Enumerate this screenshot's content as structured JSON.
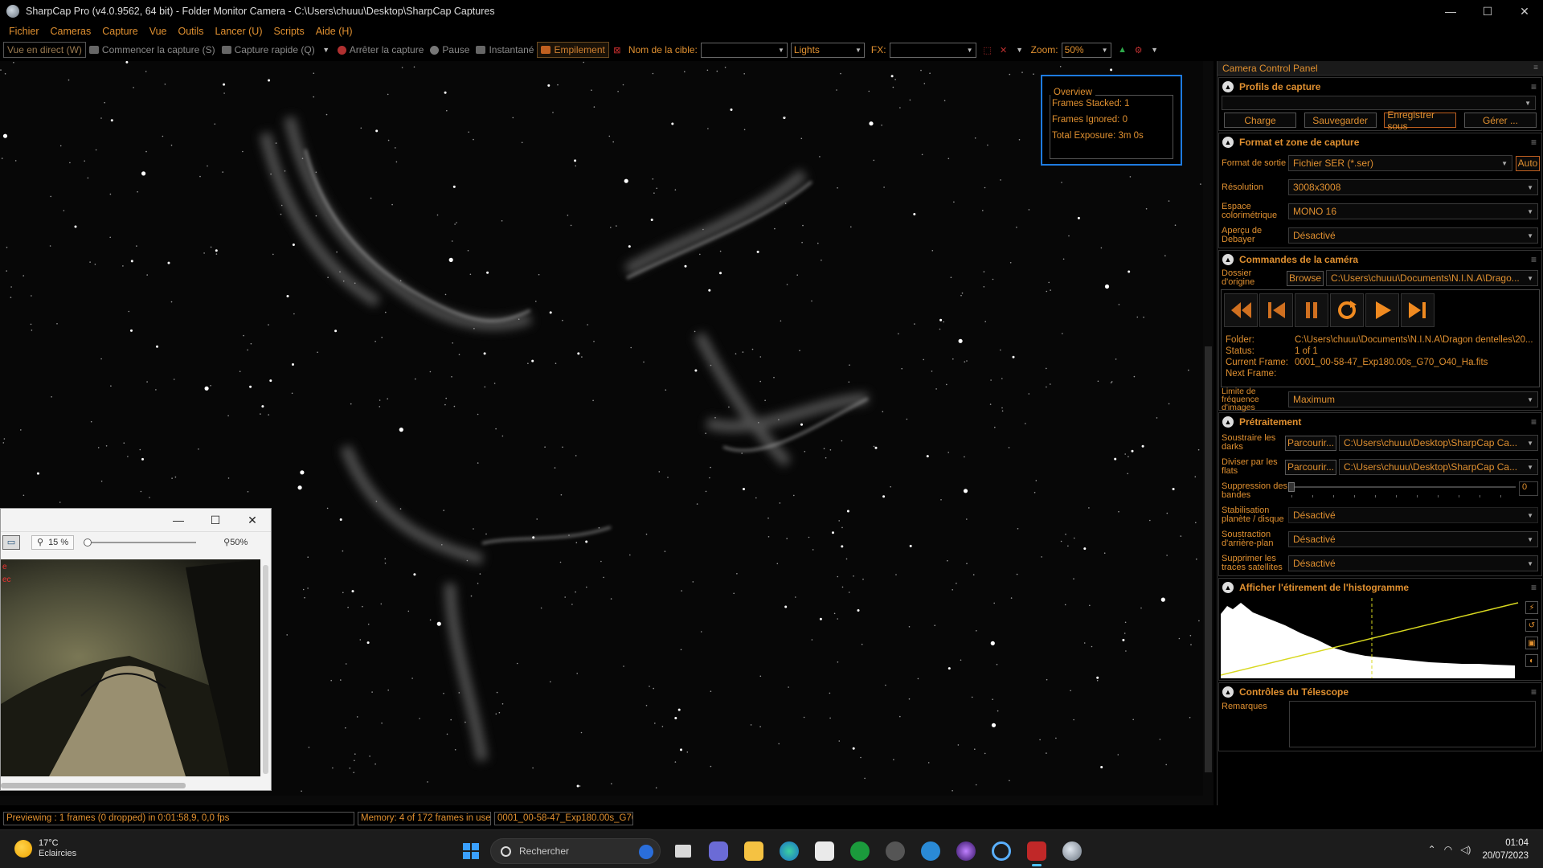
{
  "titlebar": {
    "title": "SharpCap Pro (v4.0.9562, 64 bit) - Folder Monitor Camera - C:\\Users\\chuuu\\Desktop\\SharpCap Captures",
    "minimize": "—",
    "maximize": "☐",
    "close": "✕"
  },
  "menu": [
    "Fichier",
    "Cameras",
    "Capture",
    "Vue",
    "Outils",
    "Lancer (U)",
    "Scripts",
    "Aide (H)"
  ],
  "toolbar": {
    "live_view": "Vue en direct (W)",
    "start_capture": "Commencer la capture (S)",
    "quick_capture": "Capture rapide (Q)",
    "stop_capture": "Arrêter la capture",
    "pause": "Pause",
    "snapshot": "Instantané",
    "stacking": "Empilement",
    "target_label": "Nom de la cible:",
    "target_value": "",
    "frame_type": "Lights",
    "fx_label": "FX:",
    "fx_value": "",
    "zoom_label": "Zoom:",
    "zoom_value": "50%"
  },
  "overview": {
    "title": "Overview",
    "frames_stacked": "Frames Stacked: 1",
    "frames_ignored": "Frames Ignored: 0",
    "total_exposure": "Total Exposure:   3m 0s"
  },
  "floatwin": {
    "zoom_value": "15 %",
    "zoom_max": "50%",
    "minimize": "—",
    "maximize": "☐",
    "close": "✕",
    "side_text_1": "e",
    "side_text_2": "ec"
  },
  "panel": {
    "title": "Camera Control Panel",
    "profiles": {
      "header": "Profils de capture",
      "profile_value": "",
      "buttons": [
        "Charge",
        "Sauvegarder",
        "Enregistrer sous",
        "Gérer ..."
      ]
    },
    "format": {
      "header": "Format et zone de capture",
      "rows": [
        {
          "label": "Format de sortie",
          "value": "Fichier SER (*.ser)"
        },
        {
          "label": "Résolution",
          "value": "3008x3008"
        },
        {
          "label": "Espace colorimétrique",
          "value": "MONO 16"
        },
        {
          "label": "Aperçu de Debayer",
          "value": "Désactivé"
        }
      ],
      "auto_button": "Auto"
    },
    "camera": {
      "header": "Commandes de la caméra",
      "origin_label": "Dossier d'origine",
      "browse_button": "Browse",
      "origin_value": "C:\\Users\\chuuu\\Documents\\N.I.N.A\\Drago...",
      "folder_label": "Folder:",
      "folder_value": "C:\\Users\\chuuu\\Documents\\N.I.N.A\\Dragon dentelles\\20...",
      "status_label": "Status:",
      "status_value": "1 of 1",
      "current_label": "Current Frame:",
      "current_value": "0001_00-58-47_Exp180.00s_G70_O40_Ha.fits",
      "next_label": "Next Frame:",
      "next_value": "",
      "fps_label": "Limite de fréquence d'images",
      "fps_value": "Maximum"
    },
    "preproc": {
      "header": "Prétraitement",
      "darks_label": "Soustraire les darks",
      "darks_btn": "Parcourir...",
      "darks_value": "C:\\Users\\chuuu\\Desktop\\SharpCap Ca...",
      "flats_label": "Diviser par les flats",
      "flats_btn": "Parcourir...",
      "flats_value": "C:\\Users\\chuuu\\Desktop\\SharpCap Ca...",
      "banding_label": "Suppression des bandes",
      "banding_value": "0",
      "banding_level": 0,
      "stab_label": "Stabilisation planète / disque",
      "stab_value": "Désactivé",
      "bg_label": "Soustraction d'arrière-plan",
      "bg_value": "Désactivé",
      "sat_label": "Supprimer les traces satellites",
      "sat_value": "Désactivé"
    },
    "histogram": {
      "header": "Afficher l'étirement de l'histogramme"
    },
    "telescope": {
      "header": "Contrôles du Télescope",
      "remarks_label": "Remarques",
      "remarks_value": ""
    }
  },
  "status": {
    "previewing": "Previewing : 1 frames (0 dropped) in 0:01:58,9, 0,0 fps",
    "memory": "Memory: 4 of 172 frames in use.",
    "file": "0001_00-58-47_Exp180.00s_G70"
  },
  "taskbar": {
    "temp": "17°C",
    "weather": "Eclaircies",
    "search_placeholder": "Rechercher",
    "time": "01:04",
    "date": "20/07/2023"
  }
}
